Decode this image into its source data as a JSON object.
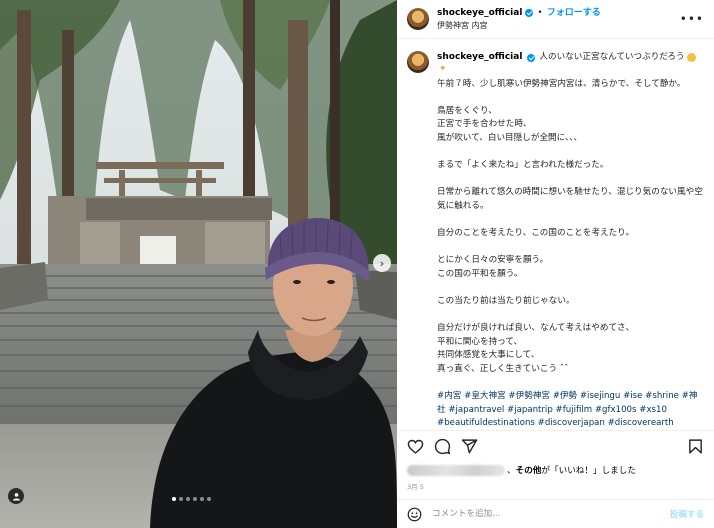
{
  "account": {
    "username": "shockeye_official",
    "separator": "•",
    "follow_label": "フォローする",
    "location": "伊勢神宮 内宮"
  },
  "caption": {
    "first_line": "人のいない正宮なんていつぶりだろう",
    "paragraphs": [
      "午前７時、少し肌寒い伊勢神宮内宮は、清らかで、そして静か。",
      "鳥居をくぐり、\n正宮で手を合わせた時、\n風が吹いて、白い目隠しが全開に、、、",
      "まるで「よく来たね」と言われた様だった。",
      "日常から離れて悠久の時間に想いを馳せたり、混じり気のない風や空気に触れる。",
      "自分のことを考えたり、この国のことを考えたり。",
      "とにかく日々の安寧を願う。\nこの国の平和を願う。",
      "この当たり前は当たり前じゃない。",
      "自分だけが良ければ良い、なんて考えはやめてさ、\n平和に関心を持って、\n共同体感覚を大事にして、\n真っ直ぐ、正しく生きていこう ˆˆ"
    ],
    "hashtags": "#内宮 #皇大神宮 #伊勢神宮 #伊勢 #isejingu #ise #shrine #神社 #japantravel #japantrip #fujifilm #gfx100s #xs10 #beautifuldestinations #discoverjapan #discoverearth #voyaged #awesome_photographers #IamATraveler #wonderful_places #japanphoto #japanphotography #japan_of_insta #livingonearth #theglobewanderer"
  },
  "likes": {
    "text": "、その他が「いいね！」しました",
    "others_bold": "その他"
  },
  "date": "3月 5",
  "comment": {
    "placeholder": "コメントを追加...",
    "post_label": "投稿する"
  },
  "carousel": {
    "total_slides": 6,
    "active_index": 0
  },
  "icons": {
    "more": "more-icon",
    "next": "chevron-right-icon",
    "user_tag": "user-tag-icon",
    "like": "heart-icon",
    "comment": "comment-icon",
    "share": "share-icon",
    "save": "bookmark-icon",
    "emoji": "emoji-icon"
  },
  "colors": {
    "accent": "#0095f6",
    "hashtag": "#00376b",
    "muted": "#8e8e8e",
    "post_disabled": "#b2dffc"
  }
}
